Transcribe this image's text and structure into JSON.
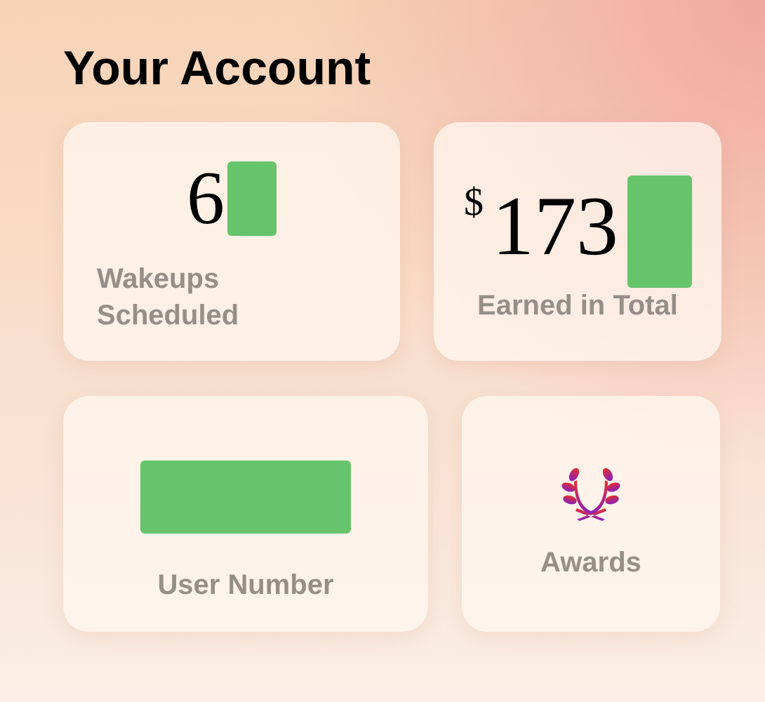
{
  "title": "Your Account",
  "cards": [
    {
      "kind": "count",
      "value": "6",
      "label": "Wakeups Scheduled"
    },
    {
      "kind": "money",
      "currency": "$",
      "value": "173",
      "label": "Earned in Total"
    },
    {
      "kind": "redacted",
      "label": "User Number"
    },
    {
      "kind": "icon",
      "label": "Awards"
    }
  ]
}
